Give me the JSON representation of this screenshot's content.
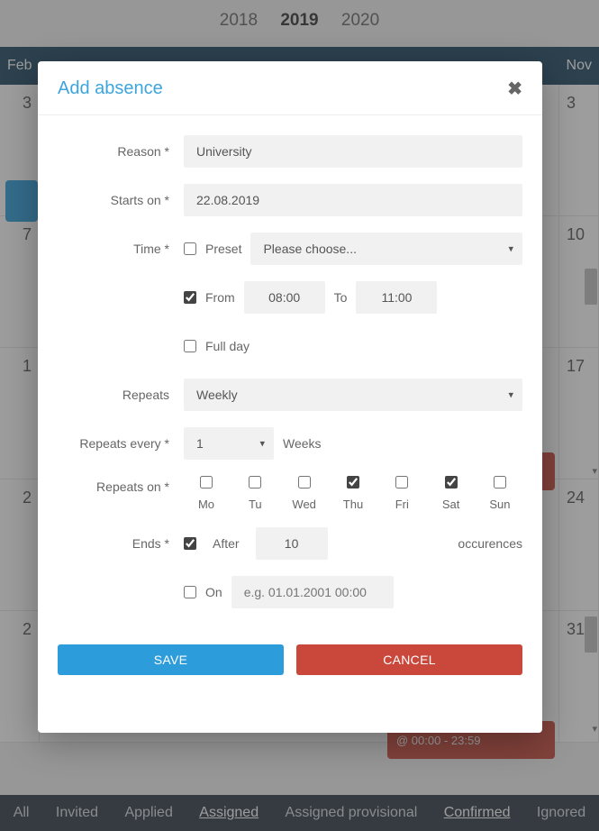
{
  "years": {
    "prev": "2018",
    "cur": "2019",
    "next": "2020"
  },
  "months": {
    "left": "Feb",
    "right": "Nov"
  },
  "grid": {
    "r1l": "3",
    "r1r": "3",
    "r2l": "7",
    "r2r": "10",
    "r3l": "1",
    "r3r": "17",
    "r4l": "2",
    "r4r": "24",
    "r5l": "2",
    "r5r": "31"
  },
  "badge_red2": "@ 00:00 - 23:59",
  "bottom": {
    "all": "All",
    "invited": "Invited",
    "applied": "Applied",
    "assigned": "Assigned",
    "assigned_prov": "Assigned provisional",
    "confirmed": "Confirmed",
    "ignored": "Ignored"
  },
  "modal": {
    "title": "Add absence",
    "reason_lbl": "Reason *",
    "reason_val": "University",
    "starts_lbl": "Starts on *",
    "starts_val": "22.08.2019",
    "time_lbl": "Time *",
    "preset_lbl": "Preset",
    "preset_sel": "Please choose...",
    "from_lbl": "From",
    "from_val": "08:00",
    "to_lbl": "To",
    "to_val": "11:00",
    "fullday_lbl": "Full day",
    "repeats_lbl": "Repeats",
    "repeats_sel": "Weekly",
    "repeats_every_lbl": "Repeats every *",
    "repeats_every_val": "1",
    "weeks_lbl": "Weeks",
    "repeats_on_lbl": "Repeats on *",
    "days": {
      "mo": "Mo",
      "tu": "Tu",
      "wed": "Wed",
      "thu": "Thu",
      "fri": "Fri",
      "sat": "Sat",
      "sun": "Sun"
    },
    "ends_lbl": "Ends *",
    "after_lbl": "After",
    "after_val": "10",
    "occ_lbl": "occurences",
    "on_lbl": "On",
    "on_ph": "e.g. 01.01.2001 00:00",
    "save": "SAVE",
    "cancel": "CANCEL"
  }
}
